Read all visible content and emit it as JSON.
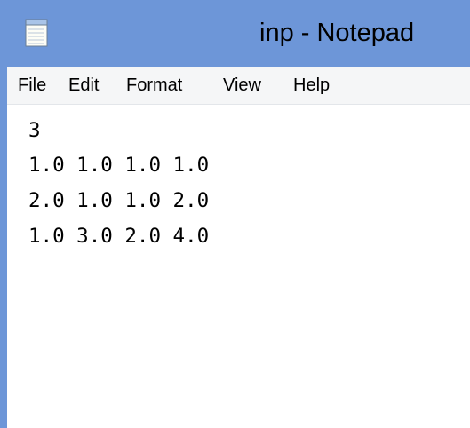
{
  "window": {
    "title": "inp - Notepad",
    "icon": "notepad-icon",
    "frame_color": "#6d96d8"
  },
  "menu": {
    "items": [
      "File",
      "Edit",
      "Format",
      "View",
      "Help"
    ]
  },
  "editor": {
    "lines": [
      "3",
      "1.0 1.0 1.0 1.0",
      "2.0 1.0 1.0 2.0",
      "1.0 3.0 2.0 4.0"
    ]
  }
}
